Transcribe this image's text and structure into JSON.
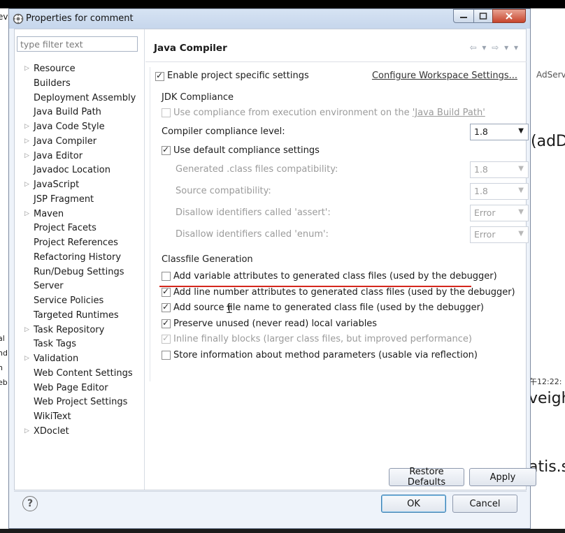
{
  "window": {
    "title": "Properties for comment"
  },
  "background": {
    "left_fragments": [
      "ev",
      "al",
      "nd",
      "n",
      "eb"
    ],
    "right_fragments": [
      "AdServ",
      "(adD",
      "午12:22:",
      "veigh",
      "atis.s"
    ]
  },
  "sidebar": {
    "filter_placeholder": "type filter text",
    "items": [
      {
        "label": "Resource",
        "expandable": true
      },
      {
        "label": "Builders",
        "expandable": false
      },
      {
        "label": "Deployment Assembly",
        "expandable": false
      },
      {
        "label": "Java Build Path",
        "expandable": false
      },
      {
        "label": "Java Code Style",
        "expandable": true
      },
      {
        "label": "Java Compiler",
        "expandable": true
      },
      {
        "label": "Java Editor",
        "expandable": true
      },
      {
        "label": "Javadoc Location",
        "expandable": false
      },
      {
        "label": "JavaScript",
        "expandable": true
      },
      {
        "label": "JSP Fragment",
        "expandable": false
      },
      {
        "label": "Maven",
        "expandable": true
      },
      {
        "label": "Project Facets",
        "expandable": false
      },
      {
        "label": "Project References",
        "expandable": false
      },
      {
        "label": "Refactoring History",
        "expandable": false
      },
      {
        "label": "Run/Debug Settings",
        "expandable": false
      },
      {
        "label": "Server",
        "expandable": false
      },
      {
        "label": "Service Policies",
        "expandable": false
      },
      {
        "label": "Targeted Runtimes",
        "expandable": false
      },
      {
        "label": "Task Repository",
        "expandable": true
      },
      {
        "label": "Task Tags",
        "expandable": false
      },
      {
        "label": "Validation",
        "expandable": true
      },
      {
        "label": "Web Content Settings",
        "expandable": false
      },
      {
        "label": "Web Page Editor",
        "expandable": false
      },
      {
        "label": "Web Project Settings",
        "expandable": false
      },
      {
        "label": "WikiText",
        "expandable": false
      },
      {
        "label": "XDoclet",
        "expandable": true
      }
    ]
  },
  "page": {
    "title": "Java Compiler",
    "nav_glyphs": "⇦ ▾ ⇨ ▾ ▾",
    "enable_specific": {
      "label": "Enable project specific settings",
      "checked": true
    },
    "configure_link": "Configure Workspace Settings...",
    "jdk": {
      "heading": "JDK Compliance",
      "use_compliance_prefix": "Use compliance from execution environment on the ",
      "use_compliance_link": "'Java Build Path'",
      "use_compliance_checked": false,
      "compliance_level_label": "Compiler compliance level:",
      "compliance_level_value": "1.8",
      "use_default": {
        "label": "Use default compliance settings",
        "checked": true
      },
      "generated_label": "Generated .class files compatibility:",
      "generated_value": "1.8",
      "source_label": "Source compatibility:",
      "source_value": "1.8",
      "assert_label": "Disallow identifiers called 'assert':",
      "assert_value": "Error",
      "enum_label": "Disallow identifiers called 'enum':",
      "enum_value": "Error"
    },
    "classfile": {
      "heading": "Classfile Generation",
      "options": [
        {
          "label": "Add variable attributes to generated class files (used by the debugger)",
          "checked": false,
          "disabled": false
        },
        {
          "label": "Add line number attributes to generated class files (used by the debugger)",
          "checked": true,
          "disabled": false
        },
        {
          "label": "Add source file name to generated class file (used by the debugger)",
          "checked": true,
          "disabled": false
        },
        {
          "label": "Preserve unused (never read) local variables",
          "checked": true,
          "disabled": false
        },
        {
          "label": "Inline finally blocks (larger class files, but improved performance)",
          "checked": true,
          "disabled": true
        },
        {
          "label": "Store information about method parameters (usable via reflection)",
          "checked": false,
          "disabled": false
        }
      ]
    },
    "restore_defaults": "Restore Defaults",
    "apply": "Apply"
  },
  "footer": {
    "help": "?",
    "ok": "OK",
    "cancel": "Cancel"
  },
  "colors": {
    "highlight_underline": "#d4271c",
    "close_button": "#c7442c",
    "title_bar": "#c6d6ec"
  }
}
